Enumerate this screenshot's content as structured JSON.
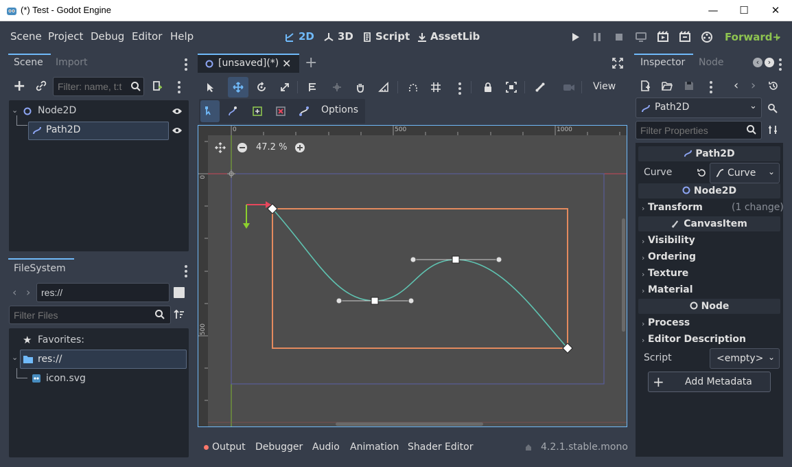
{
  "window": {
    "title": "(*) Test - Godot Engine",
    "minimize": "—",
    "maximize": "☐",
    "close": "✕"
  },
  "menu": [
    "Scene",
    "Project",
    "Debug",
    "Editor",
    "Help"
  ],
  "workspaces": [
    {
      "label": "2D",
      "active": true
    },
    {
      "label": "3D",
      "active": false
    },
    {
      "label": "Script",
      "active": false
    },
    {
      "label": "AssetLib",
      "active": false
    }
  ],
  "renderer": "Forward+",
  "scene_dock": {
    "tabs": [
      "Scene",
      "Import"
    ],
    "filter_placeholder": "Filter: name, t:t",
    "tree": [
      {
        "name": "Node2D",
        "selected": false
      },
      {
        "name": "Path2D",
        "selected": true
      }
    ]
  },
  "filesystem_dock": {
    "tab": "FileSystem",
    "path": "res://",
    "filter_placeholder": "Filter Files",
    "favorites": "Favorites:",
    "items": [
      {
        "name": "res://",
        "selected": true
      },
      {
        "name": "icon.svg",
        "selected": false
      }
    ]
  },
  "editor": {
    "tab_label": "[unsaved](*)",
    "view_label": "View",
    "options_label": "Options",
    "zoom": "47.2 %",
    "ruler_top": [
      "0",
      "500",
      "1000"
    ],
    "ruler_left": [
      "0",
      "500"
    ]
  },
  "bottom_panel": {
    "tabs": [
      "Output",
      "Debugger",
      "Audio",
      "Animation",
      "Shader Editor"
    ],
    "version": "4.2.1.stable.mono"
  },
  "inspector": {
    "tabs": [
      "Inspector",
      "Node"
    ],
    "selected_node": "Path2D",
    "filter_placeholder": "Filter Properties",
    "sections": {
      "path2d": "Path2D",
      "curve_label": "Curve",
      "curve_value": "Curve",
      "node2d": "Node2D",
      "transform": "Transform",
      "transform_changes": "(1 change)",
      "canvasitem": "CanvasItem",
      "visibility": "Visibility",
      "ordering": "Ordering",
      "texture": "Texture",
      "material": "Material",
      "node": "Node",
      "process": "Process",
      "editor_description": "Editor Description",
      "script_label": "Script",
      "script_value": "<empty>",
      "add_metadata": "Add Metadata"
    }
  },
  "colors": {
    "accent": "#70bafa",
    "path_curve": "#5fc3b1",
    "rect_outline": "#e48a5e",
    "axis_red": "#e8475d",
    "axis_green": "#8cd02e",
    "viewport_bg": "#4d4d4d"
  }
}
